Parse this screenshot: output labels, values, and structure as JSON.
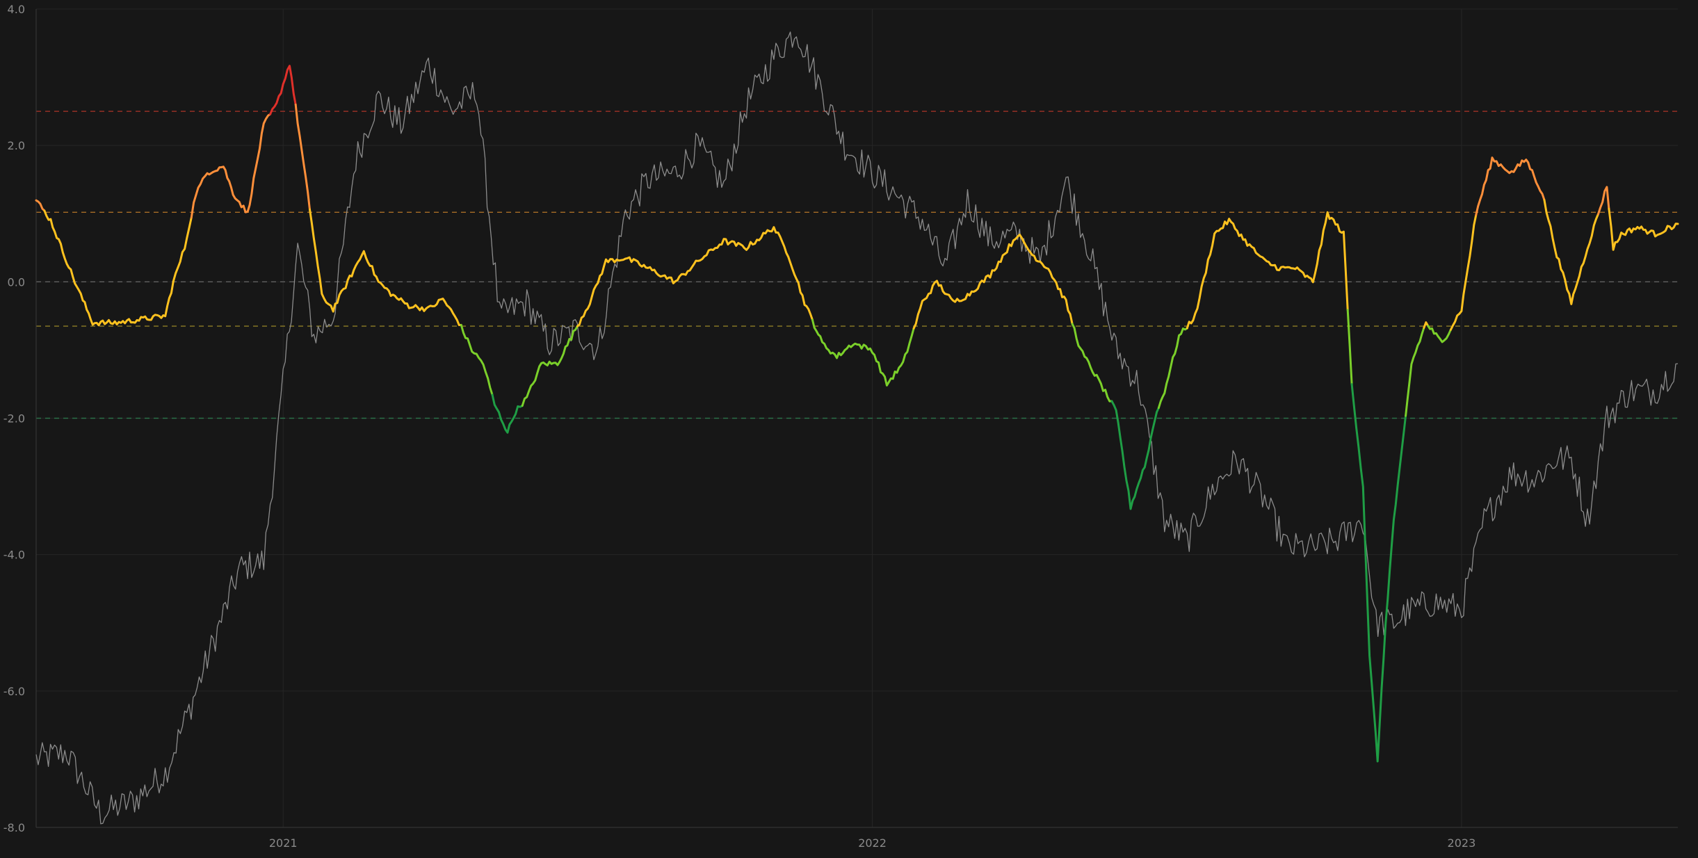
{
  "colors": {
    "background": "#171717",
    "grid": "#262626",
    "axis": "#3a3a3a",
    "tick_text": "#8a8a8a",
    "price": "#8c8c8c",
    "level_red": "#c0392b",
    "level_orange": "#d98a2b",
    "level_gray": "#777777",
    "level_olive": "#b8a12a",
    "level_green": "#2e8b57",
    "oscillator_scale": [
      "#1f9e45",
      "#7bd02a",
      "#ffc21f",
      "#ff8f3a",
      "#e0302a"
    ]
  },
  "chart_data": {
    "type": "line",
    "title": "",
    "xlabel": "",
    "ylabel": "",
    "ylim": [
      -8.0,
      4.0
    ],
    "xlim": [
      "2020-08-01",
      "2023-05-15"
    ],
    "grid": true,
    "legend": "none",
    "y_ticks": [
      "4.0",
      "2.0",
      "0.0",
      "-2.0",
      "-4.0",
      "-6.0",
      "-8.0"
    ],
    "x_ticks": [
      {
        "date": "2021-01-01",
        "label": "2021"
      },
      {
        "date": "2022-01-01",
        "label": "2022"
      },
      {
        "date": "2023-01-01",
        "label": "2023"
      }
    ],
    "reference_levels": [
      {
        "y": 2.5,
        "color_key": "level_red"
      },
      {
        "y": 1.02,
        "color_key": "level_orange"
      },
      {
        "y": 0.0,
        "color_key": "level_gray"
      },
      {
        "y": -0.65,
        "color_key": "level_olive"
      },
      {
        "y": -2.0,
        "color_key": "level_green"
      }
    ],
    "oscillator_color_thresholds": [
      -1.8,
      -0.65,
      1.02,
      2.5
    ],
    "series": [
      {
        "color_key": "price",
        "x": [
          "2020-08-01",
          "2020-08-20",
          "2020-09-10",
          "2020-10-01",
          "2020-10-20",
          "2020-11-05",
          "2020-11-20",
          "2020-12-05",
          "2020-12-20",
          "2021-01-01",
          "2021-01-10",
          "2021-01-20",
          "2021-02-01",
          "2021-02-15",
          "2021-03-01",
          "2021-03-15",
          "2021-04-01",
          "2021-04-15",
          "2021-05-01",
          "2021-05-15",
          "2021-06-01",
          "2021-06-15",
          "2021-07-01",
          "2021-07-15",
          "2021-08-01",
          "2021-08-15",
          "2021-09-01",
          "2021-09-15",
          "2021-10-01",
          "2021-10-15",
          "2021-11-01",
          "2021-11-15",
          "2021-12-01",
          "2021-12-15",
          "2022-01-01",
          "2022-01-15",
          "2022-02-01",
          "2022-02-15",
          "2022-03-01",
          "2022-03-15",
          "2022-04-01",
          "2022-04-15",
          "2022-05-01",
          "2022-05-15",
          "2022-06-01",
          "2022-06-15",
          "2022-07-01",
          "2022-07-15",
          "2022-08-01",
          "2022-08-15",
          "2022-09-01",
          "2022-09-15",
          "2022-10-01",
          "2022-10-15",
          "2022-11-01",
          "2022-11-09",
          "2022-11-20",
          "2022-12-01",
          "2022-12-15",
          "2023-01-01",
          "2023-01-15",
          "2023-02-01",
          "2023-02-15",
          "2023-03-01",
          "2023-03-10",
          "2023-03-20",
          "2023-04-01",
          "2023-04-15",
          "2023-05-01",
          "2023-05-15"
        ],
        "values": [
          -7.0,
          -6.9,
          -7.8,
          -7.6,
          -7.2,
          -6.2,
          -5.2,
          -4.2,
          -4.1,
          -1.5,
          0.5,
          -0.8,
          -0.5,
          1.8,
          2.7,
          2.3,
          3.2,
          2.5,
          2.8,
          -0.5,
          -0.3,
          -0.9,
          -0.7,
          -1.0,
          1.0,
          1.5,
          1.6,
          2.0,
          1.4,
          2.6,
          3.3,
          3.7,
          2.8,
          2.0,
          1.6,
          1.3,
          0.9,
          0.2,
          1.2,
          0.6,
          0.7,
          0.3,
          1.5,
          0.5,
          -1.0,
          -1.5,
          -3.5,
          -3.8,
          -3.0,
          -2.6,
          -3.2,
          -3.9,
          -3.9,
          -3.8,
          -3.5,
          -5.0,
          -5.0,
          -4.8,
          -4.7,
          -4.8,
          -3.5,
          -2.8,
          -2.9,
          -2.6,
          -2.6,
          -3.5,
          -2.0,
          -1.6,
          -1.6,
          -1.2
        ]
      },
      {
        "color_key": "oscillator",
        "x": [
          "2020-08-01",
          "2020-08-10",
          "2020-08-25",
          "2020-09-05",
          "2020-09-20",
          "2020-10-05",
          "2020-10-20",
          "2020-10-25",
          "2020-11-01",
          "2020-11-08",
          "2020-11-15",
          "2020-11-25",
          "2020-12-01",
          "2020-12-10",
          "2020-12-20",
          "2020-12-28",
          "2021-01-05",
          "2021-01-15",
          "2021-01-25",
          "2021-02-01",
          "2021-02-10",
          "2021-02-20",
          "2021-03-01",
          "2021-03-10",
          "2021-03-20",
          "2021-04-01",
          "2021-04-10",
          "2021-04-20",
          "2021-04-28",
          "2021-05-05",
          "2021-05-12",
          "2021-05-20",
          "2021-05-25",
          "2021-06-01",
          "2021-06-10",
          "2021-06-20",
          "2021-07-01",
          "2021-07-10",
          "2021-07-20",
          "2021-08-01",
          "2021-08-15",
          "2021-09-01",
          "2021-09-15",
          "2021-10-01",
          "2021-10-15",
          "2021-11-01",
          "2021-11-10",
          "2021-11-20",
          "2021-12-01",
          "2021-12-10",
          "2021-12-20",
          "2022-01-01",
          "2022-01-10",
          "2022-01-20",
          "2022-02-01",
          "2022-02-10",
          "2022-02-20",
          "2022-03-01",
          "2022-03-15",
          "2022-04-01",
          "2022-04-10",
          "2022-04-20",
          "2022-05-01",
          "2022-05-10",
          "2022-05-20",
          "2022-06-01",
          "2022-06-10",
          "2022-06-20",
          "2022-06-25",
          "2022-07-01",
          "2022-07-10",
          "2022-07-20",
          "2022-08-01",
          "2022-08-10",
          "2022-08-20",
          "2022-09-01",
          "2022-09-10",
          "2022-09-20",
          "2022-10-01",
          "2022-10-10",
          "2022-10-20",
          "2022-10-25",
          "2022-11-01",
          "2022-11-05",
          "2022-11-10",
          "2022-11-15",
          "2022-11-20",
          "2022-11-25",
          "2022-12-01",
          "2022-12-10",
          "2022-12-20",
          "2023-01-01",
          "2023-01-10",
          "2023-01-20",
          "2023-02-01",
          "2023-02-10",
          "2023-02-20",
          "2023-03-01",
          "2023-03-10",
          "2023-03-20",
          "2023-04-01",
          "2023-04-05",
          "2023-04-10",
          "2023-04-20",
          "2023-05-01",
          "2023-05-15"
        ],
        "values": [
          1.2,
          0.9,
          0.0,
          -0.6,
          -0.6,
          -0.55,
          -0.5,
          0.0,
          0.5,
          1.3,
          1.6,
          1.7,
          1.3,
          1.0,
          2.3,
          2.6,
          3.2,
          1.5,
          -0.2,
          -0.4,
          0.0,
          0.45,
          0.0,
          -0.2,
          -0.35,
          -0.4,
          -0.25,
          -0.6,
          -1.0,
          -1.2,
          -1.8,
          -2.2,
          -1.9,
          -1.7,
          -1.2,
          -1.2,
          -0.7,
          -0.3,
          0.3,
          0.35,
          0.2,
          0.0,
          0.3,
          0.6,
          0.5,
          0.8,
          0.4,
          -0.3,
          -0.9,
          -1.1,
          -0.9,
          -1.0,
          -1.5,
          -1.2,
          -0.3,
          0.0,
          -0.3,
          -0.2,
          0.1,
          0.7,
          0.4,
          0.2,
          -0.3,
          -1.0,
          -1.4,
          -1.9,
          -3.3,
          -2.6,
          -2.0,
          -1.6,
          -0.8,
          -0.5,
          0.7,
          0.9,
          0.6,
          0.3,
          0.2,
          0.2,
          0.0,
          1.0,
          0.7,
          -1.5,
          -3.0,
          -5.5,
          -7.0,
          -5.0,
          -3.5,
          -2.5,
          -1.2,
          -0.6,
          -0.9,
          -0.4,
          1.0,
          1.8,
          1.6,
          1.8,
          1.3,
          0.4,
          -0.3,
          0.5,
          1.4,
          0.5,
          0.7,
          0.8,
          0.7,
          0.85
        ]
      }
    ]
  }
}
